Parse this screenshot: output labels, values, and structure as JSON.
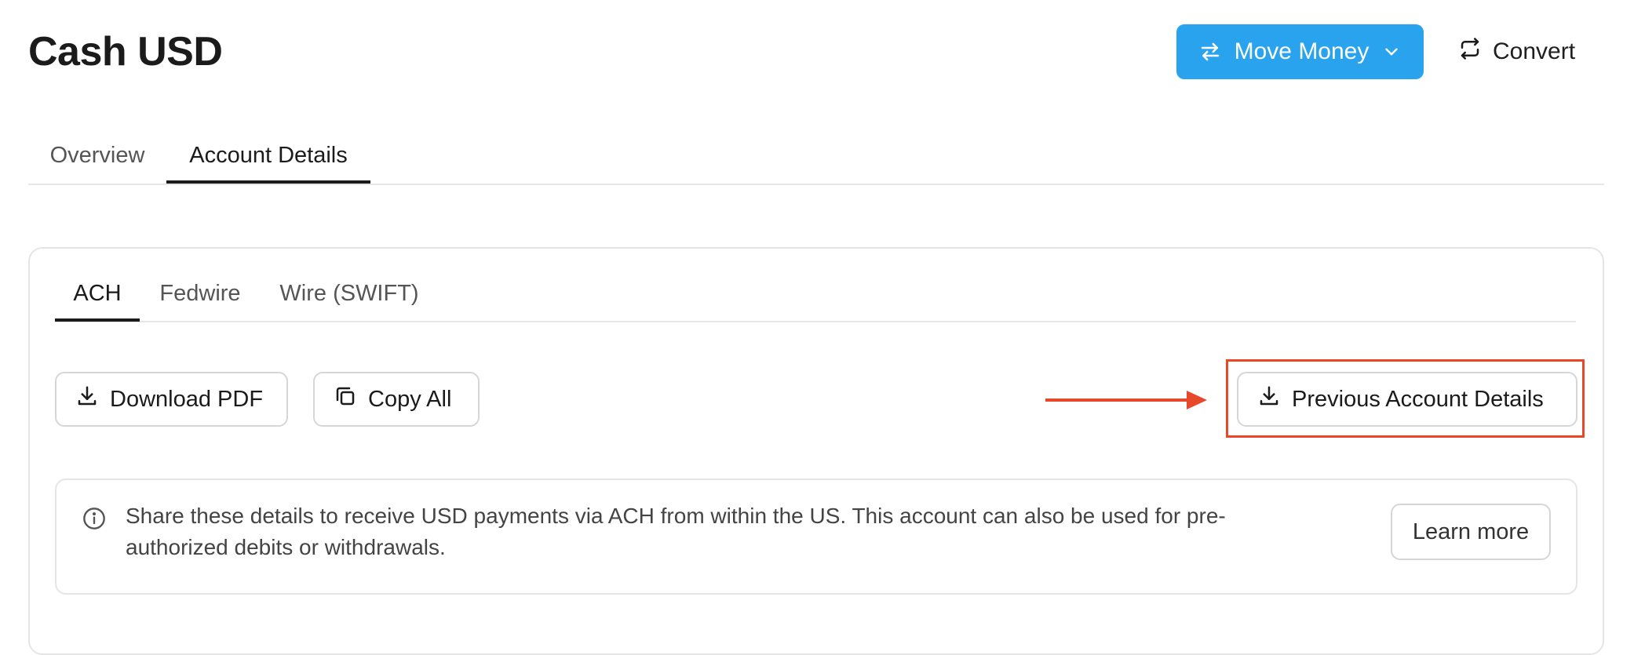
{
  "header": {
    "title": "Cash USD",
    "move_money_label": "Move Money",
    "convert_label": "Convert"
  },
  "main_tabs": [
    {
      "label": "Overview",
      "active": false
    },
    {
      "label": "Account Details",
      "active": true
    }
  ],
  "transfer_tabs": [
    {
      "label": "ACH",
      "active": true
    },
    {
      "label": "Fedwire",
      "active": false
    },
    {
      "label": "Wire (SWIFT)",
      "active": false
    }
  ],
  "actions": {
    "download_pdf_label": "Download PDF",
    "copy_all_label": "Copy All",
    "previous_details_label": "Previous Account Details"
  },
  "info": {
    "text": "Share these details to receive USD payments via ACH from within the US. This account can also be used for pre-authorized debits or withdrawals.",
    "learn_more_label": "Learn more"
  },
  "icons": {
    "move_money": "swap-arrows-icon",
    "move_money_dropdown": "chevron-down-icon",
    "convert": "repeat-icon",
    "download": "download-icon",
    "copy": "copy-icon",
    "info": "info-icon",
    "annotation": "arrow-right-icon"
  },
  "colors": {
    "primary": "#2aa3ef",
    "annotation": "#e8472a",
    "text": "#1b1b1b",
    "border": "#e5e5e5"
  }
}
